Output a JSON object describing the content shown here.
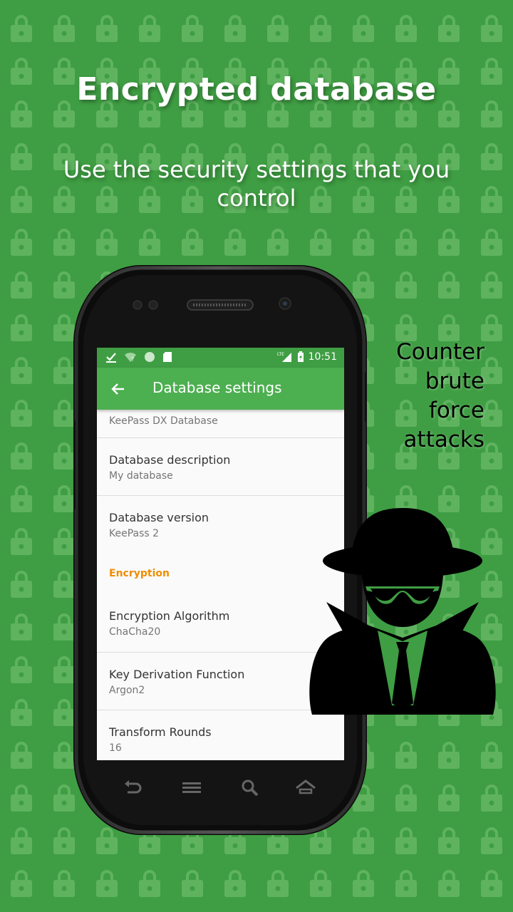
{
  "headline": {
    "title": "Encrypted database",
    "subtitle": "Use the security settings that you control"
  },
  "side_text": [
    "Counter",
    "brute",
    "force",
    "attacks"
  ],
  "colors": {
    "background": "#3f9e43",
    "lock_pattern": "#5fb35f",
    "status_bar": "#3f9e43",
    "app_bar": "#4caf50",
    "category_accent": "#ef8d00"
  },
  "status_bar": {
    "left_icons": [
      "check-icon",
      "wifi-unknown-icon",
      "circle-icon",
      "sd-card-icon"
    ],
    "network": "LTE",
    "time": "10:51"
  },
  "app_bar": {
    "back_icon": "arrow-left-icon",
    "title": "Database settings"
  },
  "settings": {
    "database_name": {
      "summary": "KeePass DX Database"
    },
    "database_description": {
      "title": "Database description",
      "summary": "My database"
    },
    "database_version": {
      "title": "Database version",
      "summary": "KeePass 2"
    },
    "encryption_category": "Encryption",
    "encryption_algorithm": {
      "title": "Encryption Algorithm",
      "summary": "ChaCha20"
    },
    "key_derivation": {
      "title": "Key Derivation Function",
      "summary": "Argon2"
    },
    "transform_rounds": {
      "title": "Transform Rounds",
      "summary": "16"
    }
  },
  "nav_keys": [
    "back-key-icon",
    "menu-key-icon",
    "search-key-icon",
    "home-key-icon"
  ],
  "illustration": "spy-icon"
}
